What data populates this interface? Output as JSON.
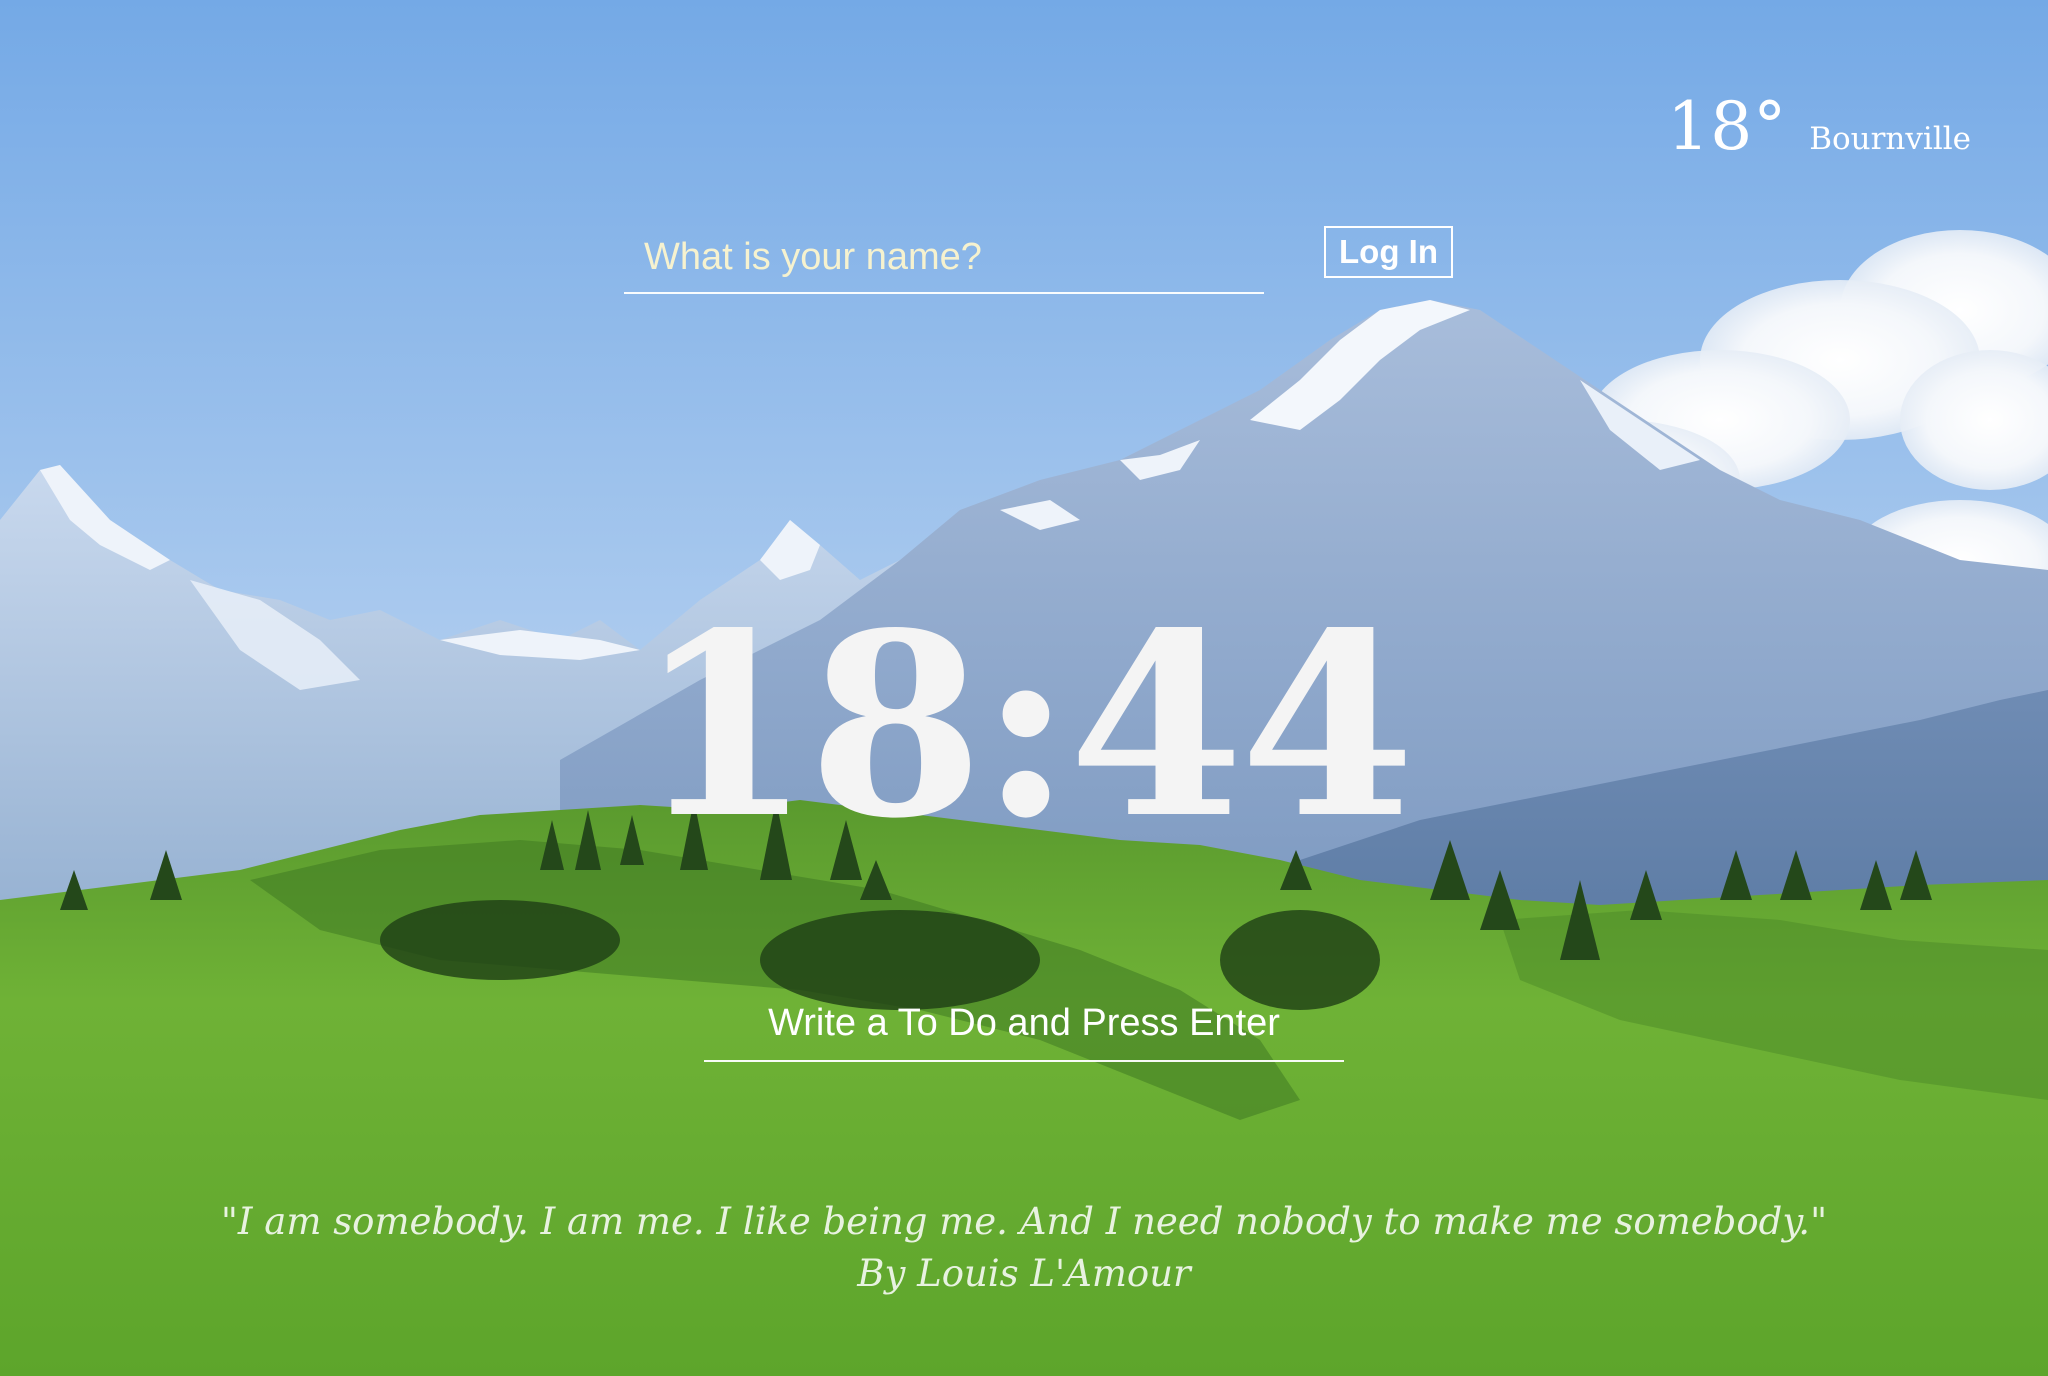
{
  "weather": {
    "temperature": "18°",
    "location": "Bournville",
    "icon": "weather-icon"
  },
  "login": {
    "name_placeholder": "What is your name?",
    "name_value": "",
    "button_label": "Log In"
  },
  "clock": {
    "time": "18:44"
  },
  "todo": {
    "placeholder": "Write a To Do and Press Enter",
    "value": ""
  },
  "quote": {
    "text": "\"I am somebody. I am me. I like being me. And I need nobody to make me somebody.\"",
    "author": "By Louis L'Amour"
  },
  "background": {
    "description_colors": {
      "sky_top": "#7aaee8",
      "sky_bottom": "#b9d4f0",
      "mountain": "#8fa8c9",
      "snow": "#eef3fa",
      "grass_light": "#6fb23a",
      "grass_dark": "#3c7a22"
    }
  }
}
